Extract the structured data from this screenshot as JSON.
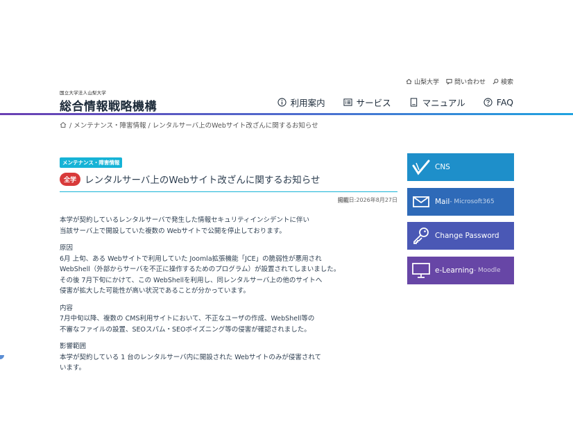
{
  "utility": {
    "university": "山梨大学",
    "contact": "問い合わせ",
    "search": "検索"
  },
  "logo": {
    "sub": "国立大学法人山梨大学",
    "main": "総合情報戦略機構"
  },
  "nav": [
    {
      "label": "利用案内",
      "icon": "info-circle-icon"
    },
    {
      "label": "サービス",
      "icon": "list-icon"
    },
    {
      "label": "マニュアル",
      "icon": "book-icon"
    },
    {
      "label": "FAQ",
      "icon": "question-circle-icon"
    }
  ],
  "breadcrumb": {
    "text": "/ メンテナンス・障害情報 / レンタルサーバ上のWebサイト改ざんに関するお知らせ"
  },
  "article": {
    "category": "メンテナンス・障害情報",
    "scope": "全学",
    "title": "レンタルサーバ上のWebサイト改ざんに関するお知らせ",
    "date_label": "掲載",
    "date_value": "日:2026年8月27日",
    "p1a": "本学が契約しているレンタルサーバで発生した情報セキュリティインシデントに伴い",
    "p1b": "当該サーバ上で開設していた複数の Webサイトで公開を停止しております。",
    "h_cause": "原因",
    "p2a": "6月 上旬、ある Webサイトで利用していた Joomla拡張機能「JCE」の脆弱性が悪用され",
    "p2b": "WebShell（外部からサーバを不正に操作するためのプログラム）が設置されてしまいました。",
    "p2c": "その後 7月下旬にかけて、この WebShellを利用し、同レンタルサーバ上の他のサイトへ",
    "p2d": "侵害が拡大した可能性が高い状況であることが分かっています。",
    "h_content": "内容",
    "p3a": "7月中旬以降、複数の CMS利用サイトにおいて、不正なユーザの作成、WebShell等の",
    "p3b": "不審なファイルの設置、SEOスパム・SEOポイズニング等の侵害が確認されました。",
    "h_scope": "影響範囲",
    "p4a": "本学が契約している 1 台のレンタルサーバ内に開設された Webサイトのみが侵害されて",
    "p4b": "います。"
  },
  "side": [
    {
      "label": "CNS",
      "sub": "",
      "icon": "cns-check-icon",
      "color": "#1e8fca"
    },
    {
      "label": "Mail",
      "sub": " - Microsoft365",
      "icon": "mail-icon",
      "color": "#2e6ab8"
    },
    {
      "label": "Change Password",
      "sub": "",
      "icon": "key-icon",
      "color": "#4a58b5"
    },
    {
      "label": "e-Learning",
      "sub": " - Moodle",
      "icon": "monitor-icon",
      "color": "#6746a6"
    }
  ]
}
